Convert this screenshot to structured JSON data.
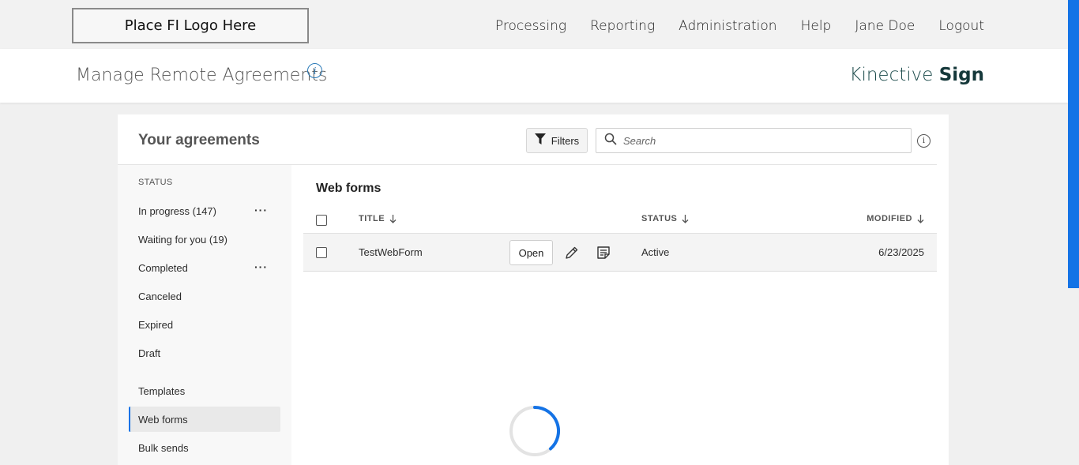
{
  "topbar": {
    "logo_text": "Place FI Logo Here",
    "nav": [
      "Processing",
      "Reporting",
      "Administration",
      "Help",
      "Jane Doe",
      "Logout"
    ]
  },
  "header": {
    "title": "Manage Remote Agreements",
    "info_glyph": "i",
    "brand_light": "Kinective ",
    "brand_bold": "Sign"
  },
  "card": {
    "title": "Your agreements",
    "filters_label": "Filters",
    "search_placeholder": "Search",
    "info_glyph": "i"
  },
  "sidebar": {
    "status_label": "STATUS",
    "items": [
      {
        "label": "In progress (147)",
        "has_menu": true
      },
      {
        "label": "Waiting for you (19)",
        "has_menu": false
      },
      {
        "label": "Completed",
        "has_menu": true
      },
      {
        "label": "Canceled",
        "has_menu": false
      },
      {
        "label": "Expired",
        "has_menu": false
      },
      {
        "label": "Draft",
        "has_menu": false
      },
      {
        "label": "Templates",
        "has_menu": false
      },
      {
        "label": "Web forms",
        "has_menu": false,
        "active": true
      },
      {
        "label": "Bulk sends",
        "has_menu": false
      }
    ],
    "menu_glyph": "···"
  },
  "content": {
    "section_title": "Web forms",
    "columns": {
      "title": "TITLE",
      "status": "STATUS",
      "modified": "MODIFIED"
    },
    "rows": [
      {
        "title": "TestWebForm",
        "open_label": "Open",
        "status": "Active",
        "modified": "6/23/2025"
      }
    ]
  },
  "colors": {
    "accent": "#1473e6",
    "brand": "#15383a"
  },
  "icons": [
    "filter-icon",
    "search-icon",
    "info-icon",
    "pencil-icon",
    "notes-icon",
    "sort-arrow-down-icon",
    "loading-spinner"
  ]
}
